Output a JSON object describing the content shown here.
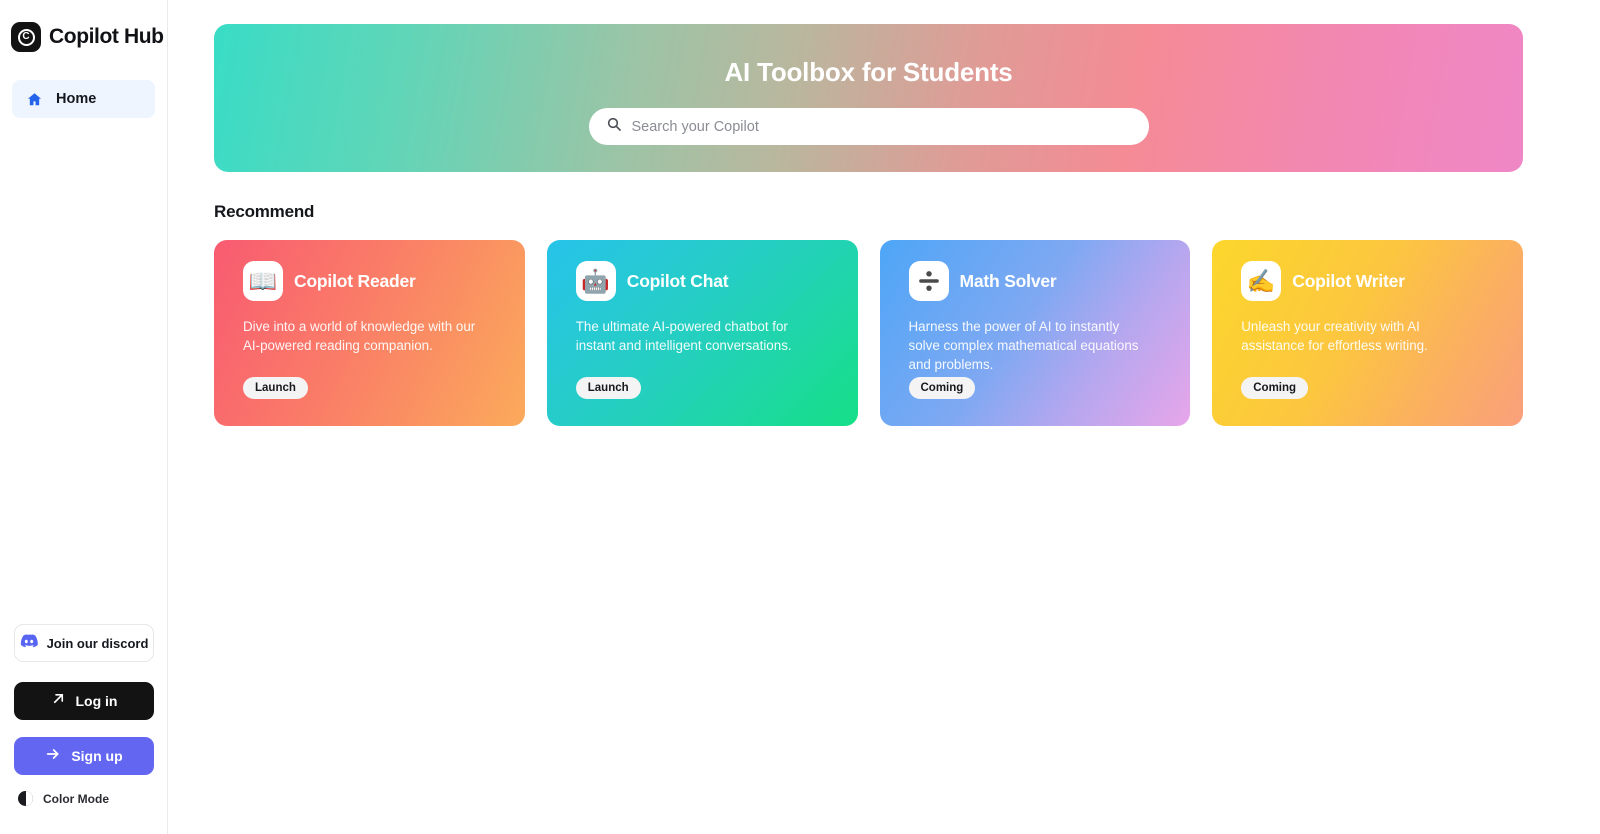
{
  "brand": {
    "name": "Copilot Hub",
    "mark_letter": "C",
    "mark_icon": "copilot-logo-icon"
  },
  "sidebar": {
    "nav": [
      {
        "label": "Home",
        "icon": "home-icon",
        "active": true
      }
    ],
    "discord": {
      "label": "Join our discord",
      "icon": "discord-icon"
    },
    "login": {
      "label": "Log in",
      "icon": "arrow-up-right-icon"
    },
    "signup": {
      "label": "Sign up",
      "icon": "arrow-right-icon"
    },
    "color_mode": {
      "label": "Color Mode",
      "icon": "half-moon-icon"
    }
  },
  "hero": {
    "title": "AI Toolbox for Students",
    "search_placeholder": "Search your Copilot",
    "search_value": "",
    "search_icon": "search-icon",
    "gradient_from": "#39dcc6",
    "gradient_to": "#ef87c6"
  },
  "main": {
    "section_title": "Recommend",
    "cards": [
      {
        "title": "Copilot Reader",
        "description": "Dive into a world of knowledge with our AI-powered reading companion.",
        "button": "Launch",
        "icon": "open-book-icon",
        "emoji": "📖",
        "gradient_from": "#f85b71",
        "gradient_to": "#fbaa5b"
      },
      {
        "title": "Copilot Chat",
        "description": "The ultimate AI-powered chatbot for instant and intelligent conversations.",
        "button": "Launch",
        "icon": "robot-icon",
        "emoji": "🤖",
        "gradient_from": "#27c3ea",
        "gradient_to": "#16df87"
      },
      {
        "title": "Math Solver",
        "description": "Harness the power of AI to instantly solve complex mathematical equations and problems.",
        "button": "Coming",
        "icon": "division-sign-icon",
        "emoji": "➗",
        "gradient_from": "#4ea6f7",
        "gradient_to": "#e8a6e9"
      },
      {
        "title": "Copilot Writer",
        "description": "Unleash your creativity with AI assistance for effortless writing.",
        "button": "Coming",
        "icon": "writing-hand-icon",
        "emoji": "✍️",
        "gradient_from": "#fcd72c",
        "gradient_to": "#fa9f7c"
      }
    ]
  }
}
